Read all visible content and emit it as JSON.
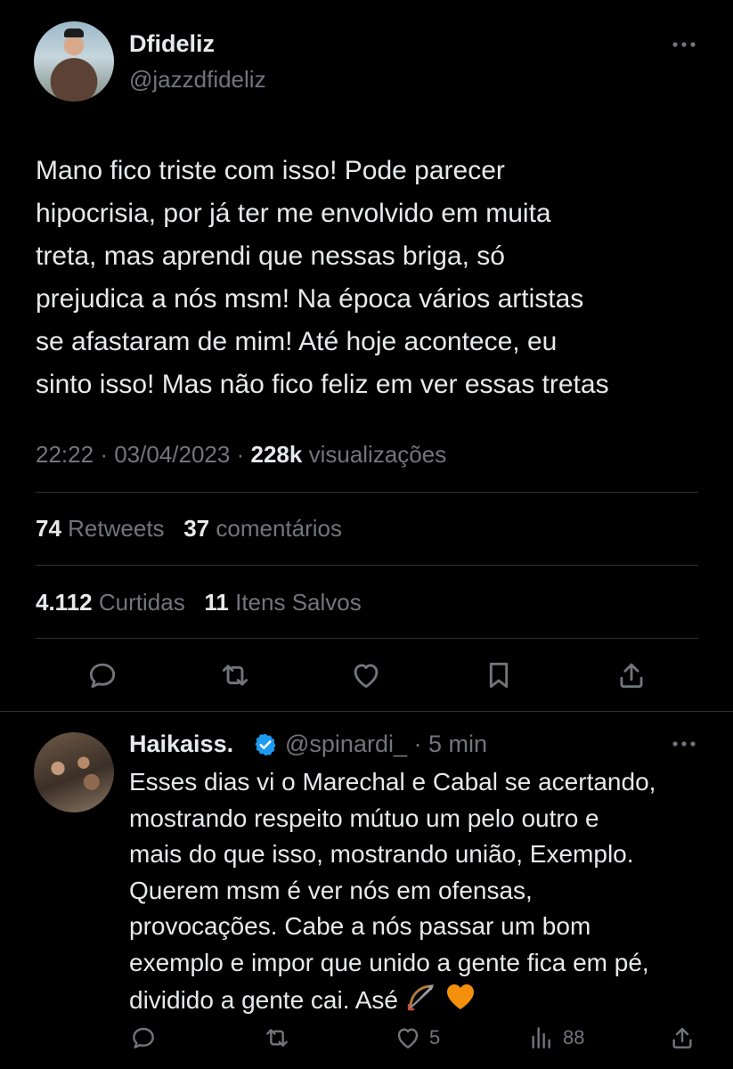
{
  "tweet": {
    "author": {
      "display_name": "Dfideliz",
      "handle": "@jazzdfideliz"
    },
    "text": "Mano fico triste com isso! Pode parecer\nhipocrisia, por já ter me envolvido em muita\ntreta, mas aprendi que nessas briga, só\nprejudica a nós msm! Na época vários artistas\nse afastaram de mim! Até hoje acontece, eu\nsinto isso! Mas não fico feliz em ver essas tretas",
    "time": "22:22",
    "date": "03/04/2023",
    "views_count": "228k",
    "views_label": "visualizações",
    "separator": "·",
    "retweets_count": "74",
    "retweets_label": "Retweets",
    "comments_count": "37",
    "comments_label": "comentários",
    "likes_count": "4.112",
    "likes_label": "Curtidas",
    "saves_count": "11",
    "saves_label": "Itens Salvos",
    "actions": [
      "reply-icon",
      "retweet-icon",
      "like-icon",
      "bookmark-icon",
      "share-icon"
    ]
  },
  "reply": {
    "author": {
      "display_name": "Haikaiss.",
      "handle": "@spinardi_",
      "time_ago": "· 5 min",
      "verified": true
    },
    "text": "Esses dias vi o Marechal e Cabal se acertando,\nmostrando respeito mútuo um pelo outro e\nmais do que isso, mostrando união, Exemplo.\nQuerem msm é ver nós em ofensas,\nprovocações. Cabe a nós passar um bom\nexemplo e impor que unido a gente fica em pé,\ndividido a gente cai. Asé",
    "emojis": [
      "bow-and-arrow-icon",
      "orange-heart-icon"
    ],
    "likes": "5",
    "views": "88",
    "actions": [
      "reply-icon",
      "retweet-icon",
      "like-icon",
      "views-icon",
      "share-icon"
    ]
  },
  "colors": {
    "background": "#000000",
    "text_primary": "#e7e9ea",
    "text_secondary": "#71767b",
    "divider": "#2f3336",
    "verified_blue": "#1d9bf0"
  }
}
